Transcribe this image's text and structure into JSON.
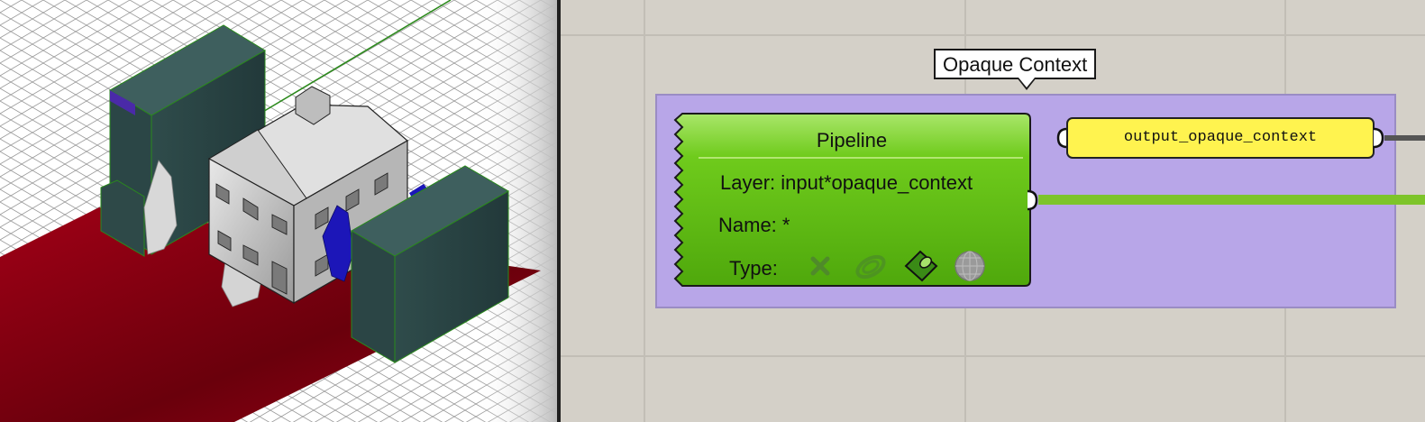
{
  "tooltip": {
    "text": "Opaque Context"
  },
  "pipeline": {
    "title": "Pipeline",
    "layer_label": "Layer:",
    "layer_value": "input*opaque_context",
    "name_label": "Name:",
    "name_value": "*",
    "type_label": "Type:",
    "type_icons": [
      "point-x-icon",
      "curve-icon",
      "surface-icon",
      "sphere-mesh-icon"
    ]
  },
  "output_panel": {
    "text": "output_opaque_context"
  },
  "colors": {
    "canvas_bg": "#d4d0c8",
    "group_bg": "#b8a6e8",
    "pipeline_green": "#5fbf12",
    "panel_yellow": "#fff34f",
    "wire_green": "#7dc42a",
    "ground_red": "#8a0012",
    "building_teal": "#3e5f5e"
  }
}
